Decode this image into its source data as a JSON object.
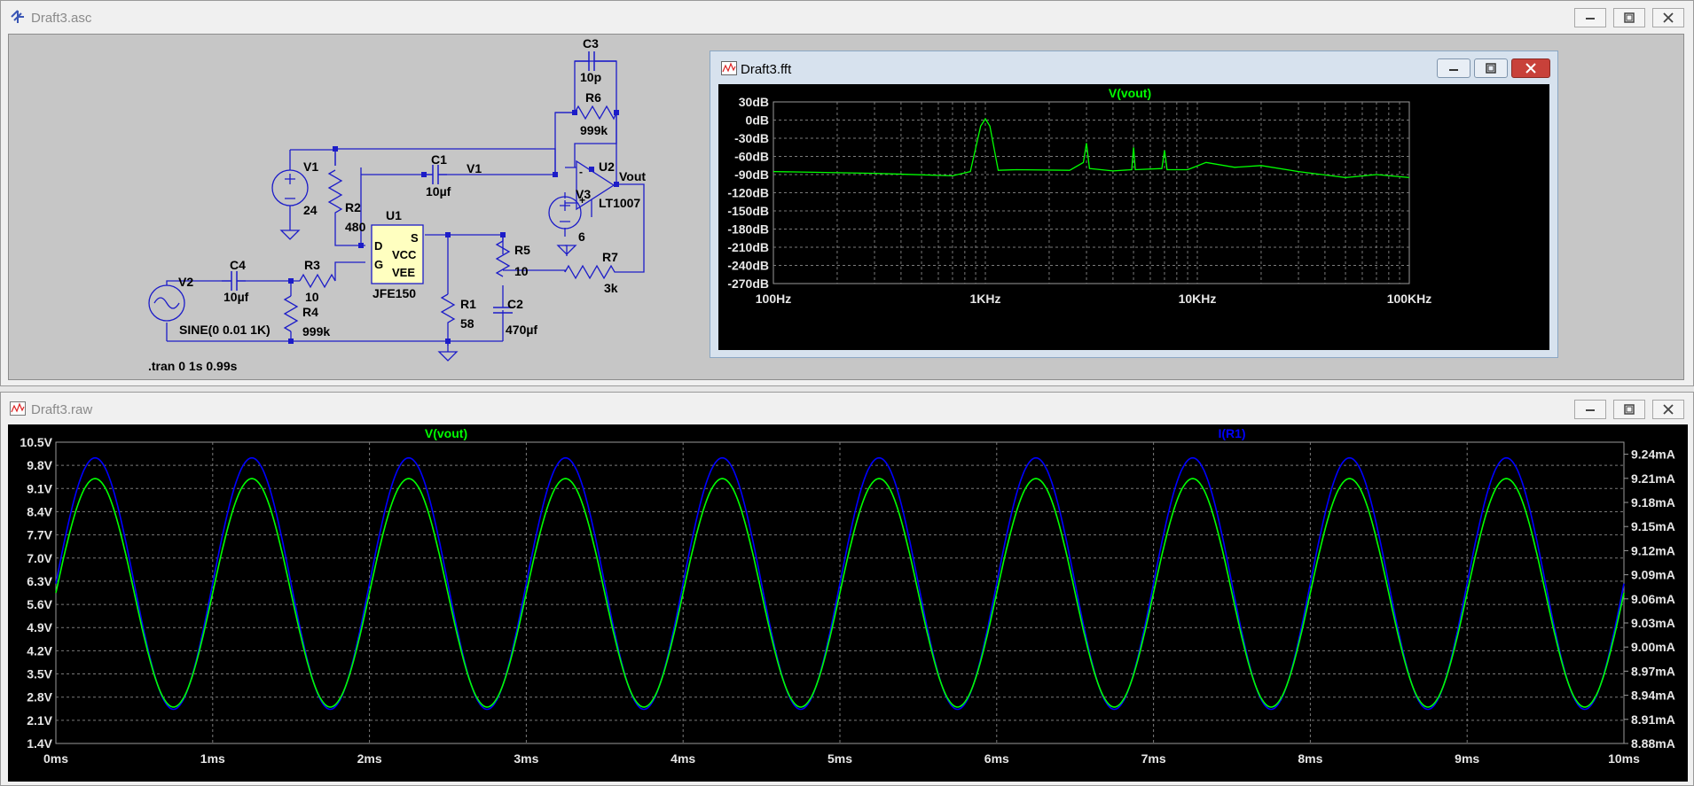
{
  "schematic": {
    "title": "Draft3.asc",
    "components": [
      {
        "id": "V1",
        "value": "24"
      },
      {
        "id": "V2",
        "value": "SINE(0 0.01 1K)"
      },
      {
        "id": "V3",
        "value": "6"
      },
      {
        "id": "C1",
        "value": "10µf"
      },
      {
        "id": "C2",
        "value": "470µf"
      },
      {
        "id": "C3",
        "value": "10p"
      },
      {
        "id": "C4",
        "value": "10µf"
      },
      {
        "id": "R1",
        "value": "58"
      },
      {
        "id": "R2",
        "value": "480"
      },
      {
        "id": "R3",
        "value": "10"
      },
      {
        "id": "R4",
        "value": "999k"
      },
      {
        "id": "R5",
        "value": "10"
      },
      {
        "id": "R6",
        "value": "999k"
      },
      {
        "id": "R7",
        "value": "3k"
      },
      {
        "id": "U1",
        "value": "JFE150",
        "pins": [
          "D",
          "G",
          "S",
          "VCC",
          "VEE"
        ]
      },
      {
        "id": "U2",
        "value": "LT1007"
      }
    ],
    "net_labels": [
      "V1",
      "Vout"
    ],
    "directive": ".tran 0 1s 0.99s"
  },
  "fft": {
    "title": "Draft3.fft",
    "trace_label": "V(vout)",
    "trace_color": "#00ff00",
    "y_ticks": [
      "30dB",
      "0dB",
      "-30dB",
      "-60dB",
      "-90dB",
      "-120dB",
      "-150dB",
      "-180dB",
      "-210dB",
      "-240dB",
      "-270dB"
    ],
    "x_ticks": [
      "100Hz",
      "1KHz",
      "10KHz",
      "100KHz"
    ],
    "chart_data": {
      "type": "line",
      "x_scale": "log",
      "xlim": [
        100,
        100000
      ],
      "ylim": [
        -270,
        30
      ],
      "series": [
        {
          "name": "V(vout)",
          "x": [
            100,
            300,
            700,
            850,
            950,
            1000,
            1050,
            1150,
            1400,
            2500,
            2900,
            3000,
            3100,
            4000,
            4900,
            5000,
            5100,
            6800,
            7000,
            7200,
            9000,
            11000,
            15000,
            20000,
            30000,
            50000,
            70000,
            100000
          ],
          "y": [
            -85,
            -88,
            -92,
            -85,
            -10,
            2,
            -10,
            -83,
            -82,
            -83,
            -70,
            -38,
            -80,
            -84,
            -82,
            -45,
            -82,
            -80,
            -50,
            -82,
            -82,
            -70,
            -78,
            -75,
            -85,
            -95,
            -90,
            -95
          ]
        }
      ]
    }
  },
  "transient": {
    "title": "Draft3.raw",
    "trace1_label": "V(vout)",
    "trace1_color": "#00ff00",
    "trace2_label": "I(R1)",
    "trace2_color": "#0000ff",
    "y_left_ticks": [
      "10.5V",
      "9.8V",
      "9.1V",
      "8.4V",
      "7.7V",
      "7.0V",
      "6.3V",
      "5.6V",
      "4.9V",
      "4.2V",
      "3.5V",
      "2.8V",
      "2.1V",
      "1.4V"
    ],
    "y_right_ticks": [
      "9.24mA",
      "9.21mA",
      "9.18mA",
      "9.15mA",
      "9.12mA",
      "9.09mA",
      "9.06mA",
      "9.03mA",
      "9.00mA",
      "8.97mA",
      "8.94mA",
      "8.91mA",
      "8.88mA"
    ],
    "x_ticks": [
      "0ms",
      "1ms",
      "2ms",
      "3ms",
      "4ms",
      "5ms",
      "6ms",
      "7ms",
      "8ms",
      "9ms",
      "10ms"
    ],
    "chart_data": {
      "type": "line",
      "xlim": [
        0,
        10
      ],
      "xunit": "ms",
      "ylim_left": [
        1.4,
        10.5
      ],
      "ylim_right": [
        8.88,
        9.255
      ],
      "frequency_hz": 1000,
      "series": [
        {
          "name": "V(vout)",
          "axis": "left",
          "offset": 5.95,
          "amplitude": 3.45,
          "phase_ms": 0
        },
        {
          "name": "I(R1)",
          "axis": "right",
          "offset": 9.079,
          "amplitude": 0.1565,
          "phase_ms": 0
        }
      ]
    }
  }
}
